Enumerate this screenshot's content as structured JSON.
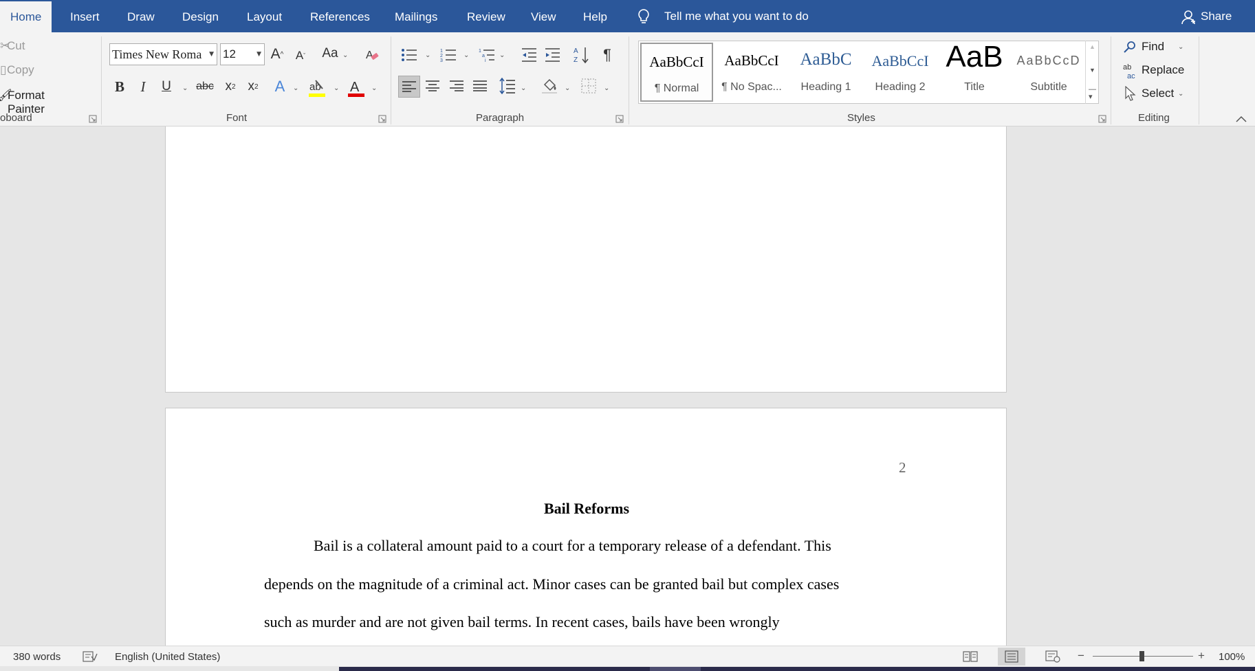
{
  "tabs": [
    {
      "label": "Home",
      "active": true
    },
    {
      "label": "Insert"
    },
    {
      "label": "Draw"
    },
    {
      "label": "Design"
    },
    {
      "label": "Layout"
    },
    {
      "label": "References"
    },
    {
      "label": "Mailings"
    },
    {
      "label": "Review"
    },
    {
      "label": "View"
    },
    {
      "label": "Help"
    }
  ],
  "tell_me": "Tell me what you want to do",
  "share_label": "Share",
  "clipboard": {
    "cut": "Cut",
    "copy": "Copy",
    "format_painter": "Format Painter",
    "group_label": "oboard"
  },
  "font": {
    "name": "Times New Roma",
    "size": "12",
    "change_case": "Aa",
    "group_label": "Font",
    "highlight_color": "#ffff00",
    "font_color": "#e00000"
  },
  "paragraph": {
    "group_label": "Paragraph"
  },
  "styles": {
    "group_label": "Styles",
    "items": [
      {
        "preview": "AaBbCcI",
        "name": "¶ Normal",
        "selected": true
      },
      {
        "preview": "AaBbCcI",
        "name": "¶ No Spac..."
      },
      {
        "preview": "AaBbC",
        "name": "Heading 1"
      },
      {
        "preview": "AaBbCcI",
        "name": "Heading 2"
      },
      {
        "preview": "AaB",
        "name": "Title"
      },
      {
        "preview": "AaBbCcD",
        "name": "Subtitle"
      }
    ]
  },
  "editing": {
    "find": "Find",
    "replace": "Replace",
    "select": "Select",
    "group_label": "Editing"
  },
  "document": {
    "page_number": "2",
    "title": "Bail Reforms",
    "lines": [
      "Bail is a collateral amount paid to a court for a temporary release of a defendant. This",
      "depends on the magnitude of a criminal act. Minor cases can be granted bail but complex cases",
      "such as murder and are not given bail terms. In recent cases, bails have been wrongly"
    ]
  },
  "status": {
    "word_count": "380 words",
    "language": "English (United States)",
    "zoom": "100%"
  },
  "colors": {
    "accent": "#2b579a",
    "ribbon_bg": "#f3f3f3",
    "canvas_bg": "#e6e6e6"
  }
}
